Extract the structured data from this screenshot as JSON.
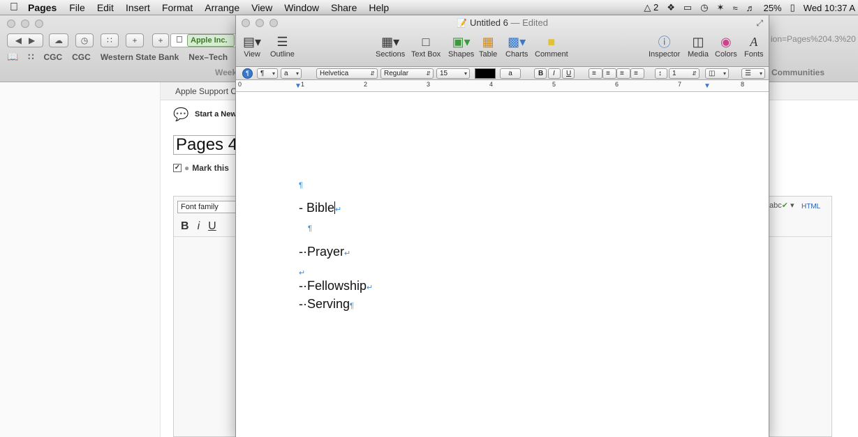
{
  "menubar": {
    "app_name": "Pages",
    "items": [
      "File",
      "Edit",
      "Insert",
      "Format",
      "Arrange",
      "View",
      "Window",
      "Share",
      "Help"
    ],
    "status": {
      "adobe_count": "2",
      "battery": "25%",
      "clock": "Wed 10:37 A"
    }
  },
  "browser": {
    "address_site_label": "Apple Inc.",
    "address_tail": "ion=Pages%204.3%20",
    "bookmarks": [
      "CGC",
      "CGC",
      "Western State Bank",
      "Nex–Tech"
    ],
    "tab_left": "Week",
    "tab_right": "Communities",
    "support_label": "Apple Support C",
    "start_new": "Start a New",
    "title_field": "Pages 4",
    "mark_label": "Mark this",
    "font_family_select": "Font family",
    "editor_bold": "B",
    "editor_italic": "i",
    "editor_underline": "U",
    "spell_label": "abc",
    "html_link": "HTML"
  },
  "pages_window": {
    "title": "Untitled 6",
    "title_status": "— Edited",
    "toolbar": [
      {
        "name": "view",
        "label": "View",
        "icon": "view-icon"
      },
      {
        "name": "outline",
        "label": "Outline",
        "icon": "outline-icon"
      },
      {
        "name": "sections",
        "label": "Sections",
        "icon": "sections-icon"
      },
      {
        "name": "text-box",
        "label": "Text Box",
        "icon": "text-box-icon"
      },
      {
        "name": "shapes",
        "label": "Shapes",
        "icon": "shapes-icon"
      },
      {
        "name": "table",
        "label": "Table",
        "icon": "table-icon"
      },
      {
        "name": "charts",
        "label": "Charts",
        "icon": "charts-icon"
      },
      {
        "name": "comment",
        "label": "Comment",
        "icon": "comment-icon"
      },
      {
        "name": "inspector",
        "label": "Inspector",
        "icon": "inspector-icon"
      },
      {
        "name": "media",
        "label": "Media",
        "icon": "media-icon"
      },
      {
        "name": "colors",
        "label": "Colors",
        "icon": "colors-icon"
      },
      {
        "name": "fonts",
        "label": "Fonts",
        "icon": "fonts-icon"
      }
    ],
    "format_bar": {
      "paragraph_style": "¶",
      "character_style": "a",
      "font_family": "Helvetica",
      "font_typeface": "Regular",
      "font_size": "15",
      "highlight_label": "a",
      "bold": "B",
      "italic": "I",
      "underline": "U",
      "line_spacing": "1"
    },
    "ruler_numbers": [
      "0",
      "1",
      "2",
      "3",
      "4",
      "5",
      "6",
      "7",
      "8"
    ],
    "document_lines": [
      {
        "prefix": "",
        "text": "",
        "mark": "¶"
      },
      {
        "prefix": "- ",
        "text": "Bible",
        "mark": "↵"
      },
      {
        "prefix": "",
        "text": "",
        "mark": "¶"
      },
      {
        "prefix": "-·",
        "text": "Prayer",
        "mark": "↵"
      },
      {
        "prefix": "",
        "text": "",
        "mark": "↵"
      },
      {
        "prefix": "-·",
        "text": "Fellowship",
        "mark": "↵"
      },
      {
        "prefix": "-·",
        "text": "Serving",
        "mark": "¶"
      }
    ]
  }
}
